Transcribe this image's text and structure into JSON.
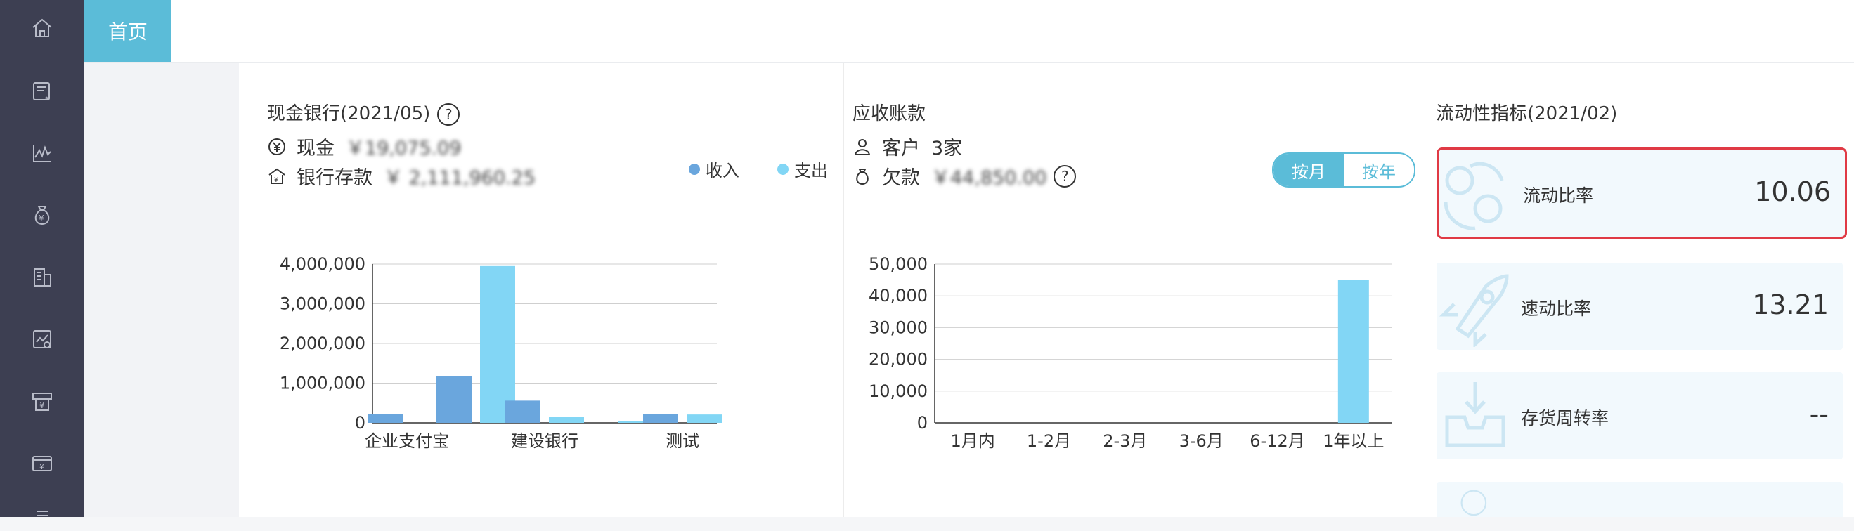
{
  "sidebar": {
    "icons": [
      "home-icon",
      "invoice-icon",
      "line-chart-icon",
      "money-bag-icon",
      "building-icon",
      "report-icon",
      "cash-register-icon",
      "tax-icon",
      "more-icon"
    ]
  },
  "tabs": [
    {
      "label": "首页",
      "active": true
    }
  ],
  "cash_bank": {
    "title": "现金银行(2021/05)",
    "cash_label": "现金",
    "cash_value": "￥19,075.09",
    "bank_label": "银行存款",
    "bank_value": "￥ 2,111,960.25",
    "legend": [
      {
        "name": "收入",
        "color": "#6aa6dd"
      },
      {
        "name": "支出",
        "color": "#82d6f5"
      }
    ]
  },
  "receivables": {
    "title": "应收账款",
    "customers_label": "客户",
    "customers_value": "3家",
    "debt_label": "欠款",
    "debt_value": "￥44,850.00",
    "toggle": {
      "month": "按月",
      "year": "按年",
      "selected": "按月"
    }
  },
  "liquidity": {
    "title": "流动性指标(2021/02)",
    "cards": [
      {
        "label": "流动比率",
        "value": "10.06",
        "selected": true
      },
      {
        "label": "速动比率",
        "value": "13.21",
        "selected": false
      },
      {
        "label": "存货周转率",
        "value": "--",
        "selected": false
      }
    ]
  },
  "chart_data": [
    {
      "type": "bar",
      "title": "",
      "categories": [
        "企业支付宝",
        "",
        "建设银行",
        "",
        "测试"
      ],
      "series": [
        {
          "name": "收入",
          "values": [
            230000,
            1170000,
            560000,
            0,
            220000
          ]
        },
        {
          "name": "支出",
          "values": [
            0,
            3950000,
            150000,
            50000,
            210000
          ]
        }
      ],
      "ylim": [
        0,
        4000000
      ],
      "yticks": [
        "0",
        "1,000,000",
        "2,000,000",
        "3,000,000",
        "4,000,000"
      ],
      "grid": true
    },
    {
      "type": "bar",
      "title": "",
      "categories": [
        "1月内",
        "1-2月",
        "2-3月",
        "3-6月",
        "6-12月",
        "1年以上"
      ],
      "values": [
        0,
        0,
        0,
        0,
        0,
        45000
      ],
      "ylim": [
        0,
        50000
      ],
      "yticks": [
        "0",
        "10,000",
        "20,000",
        "30,000",
        "40,000",
        "50,000"
      ],
      "grid": true
    }
  ]
}
